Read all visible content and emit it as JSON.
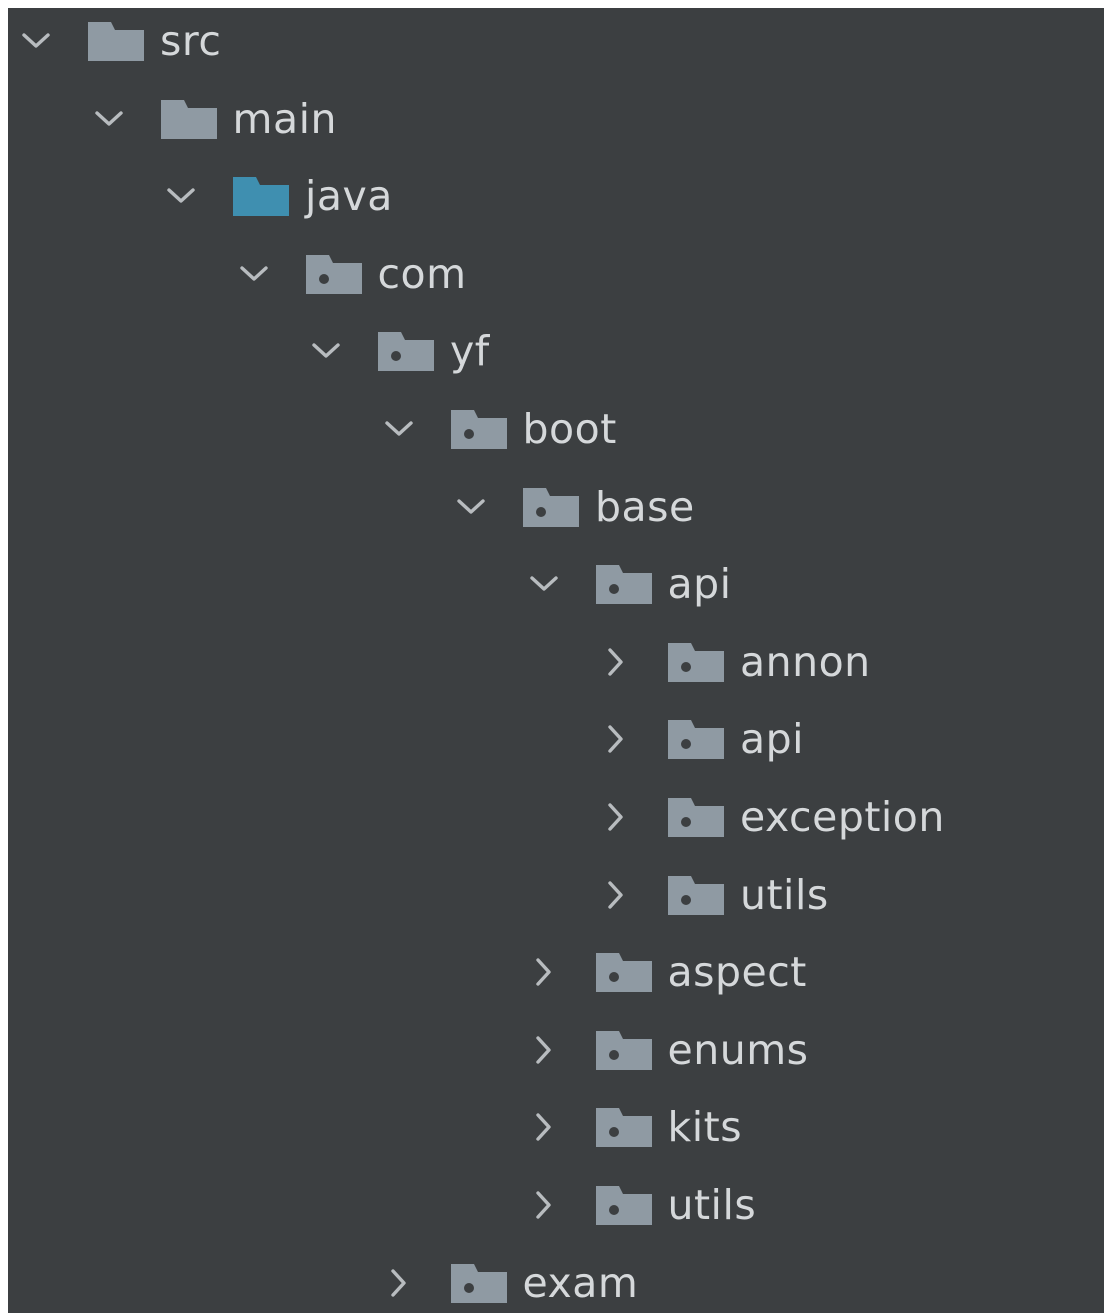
{
  "project_tree": {
    "nodes": [
      {
        "label": "src",
        "depth": 0,
        "expanded": true,
        "folder_type": "plain"
      },
      {
        "label": "main",
        "depth": 1,
        "expanded": true,
        "folder_type": "plain"
      },
      {
        "label": "java",
        "depth": 2,
        "expanded": true,
        "folder_type": "source-root"
      },
      {
        "label": "com",
        "depth": 3,
        "expanded": true,
        "folder_type": "package"
      },
      {
        "label": "yf",
        "depth": 4,
        "expanded": true,
        "folder_type": "package"
      },
      {
        "label": "boot",
        "depth": 5,
        "expanded": true,
        "folder_type": "package"
      },
      {
        "label": "base",
        "depth": 6,
        "expanded": true,
        "folder_type": "package"
      },
      {
        "label": "api",
        "depth": 7,
        "expanded": true,
        "folder_type": "package"
      },
      {
        "label": "annon",
        "depth": 8,
        "expanded": false,
        "folder_type": "package"
      },
      {
        "label": "api",
        "depth": 8,
        "expanded": false,
        "folder_type": "package"
      },
      {
        "label": "exception",
        "depth": 8,
        "expanded": false,
        "folder_type": "package"
      },
      {
        "label": "utils",
        "depth": 8,
        "expanded": false,
        "folder_type": "package"
      },
      {
        "label": "aspect",
        "depth": 7,
        "expanded": false,
        "folder_type": "package"
      },
      {
        "label": "enums",
        "depth": 7,
        "expanded": false,
        "folder_type": "package"
      },
      {
        "label": "kits",
        "depth": 7,
        "expanded": false,
        "folder_type": "package"
      },
      {
        "label": "utils",
        "depth": 7,
        "expanded": false,
        "folder_type": "package"
      },
      {
        "label": "exam",
        "depth": 5,
        "expanded": false,
        "folder_type": "package"
      }
    ]
  },
  "icons": {
    "expanded": "chevron-down-icon",
    "collapsed": "chevron-right-icon",
    "plain": "folder-icon",
    "source-root": "source-root-folder-icon",
    "package": "package-folder-icon"
  },
  "colors": {
    "background": "#3c3f41",
    "text": "#d5d8da",
    "chevron": "#b8bcbf",
    "folder": "#8f9aa3",
    "source_root_folder": "#3f8fb0",
    "package_dot": "#3c3f41"
  }
}
